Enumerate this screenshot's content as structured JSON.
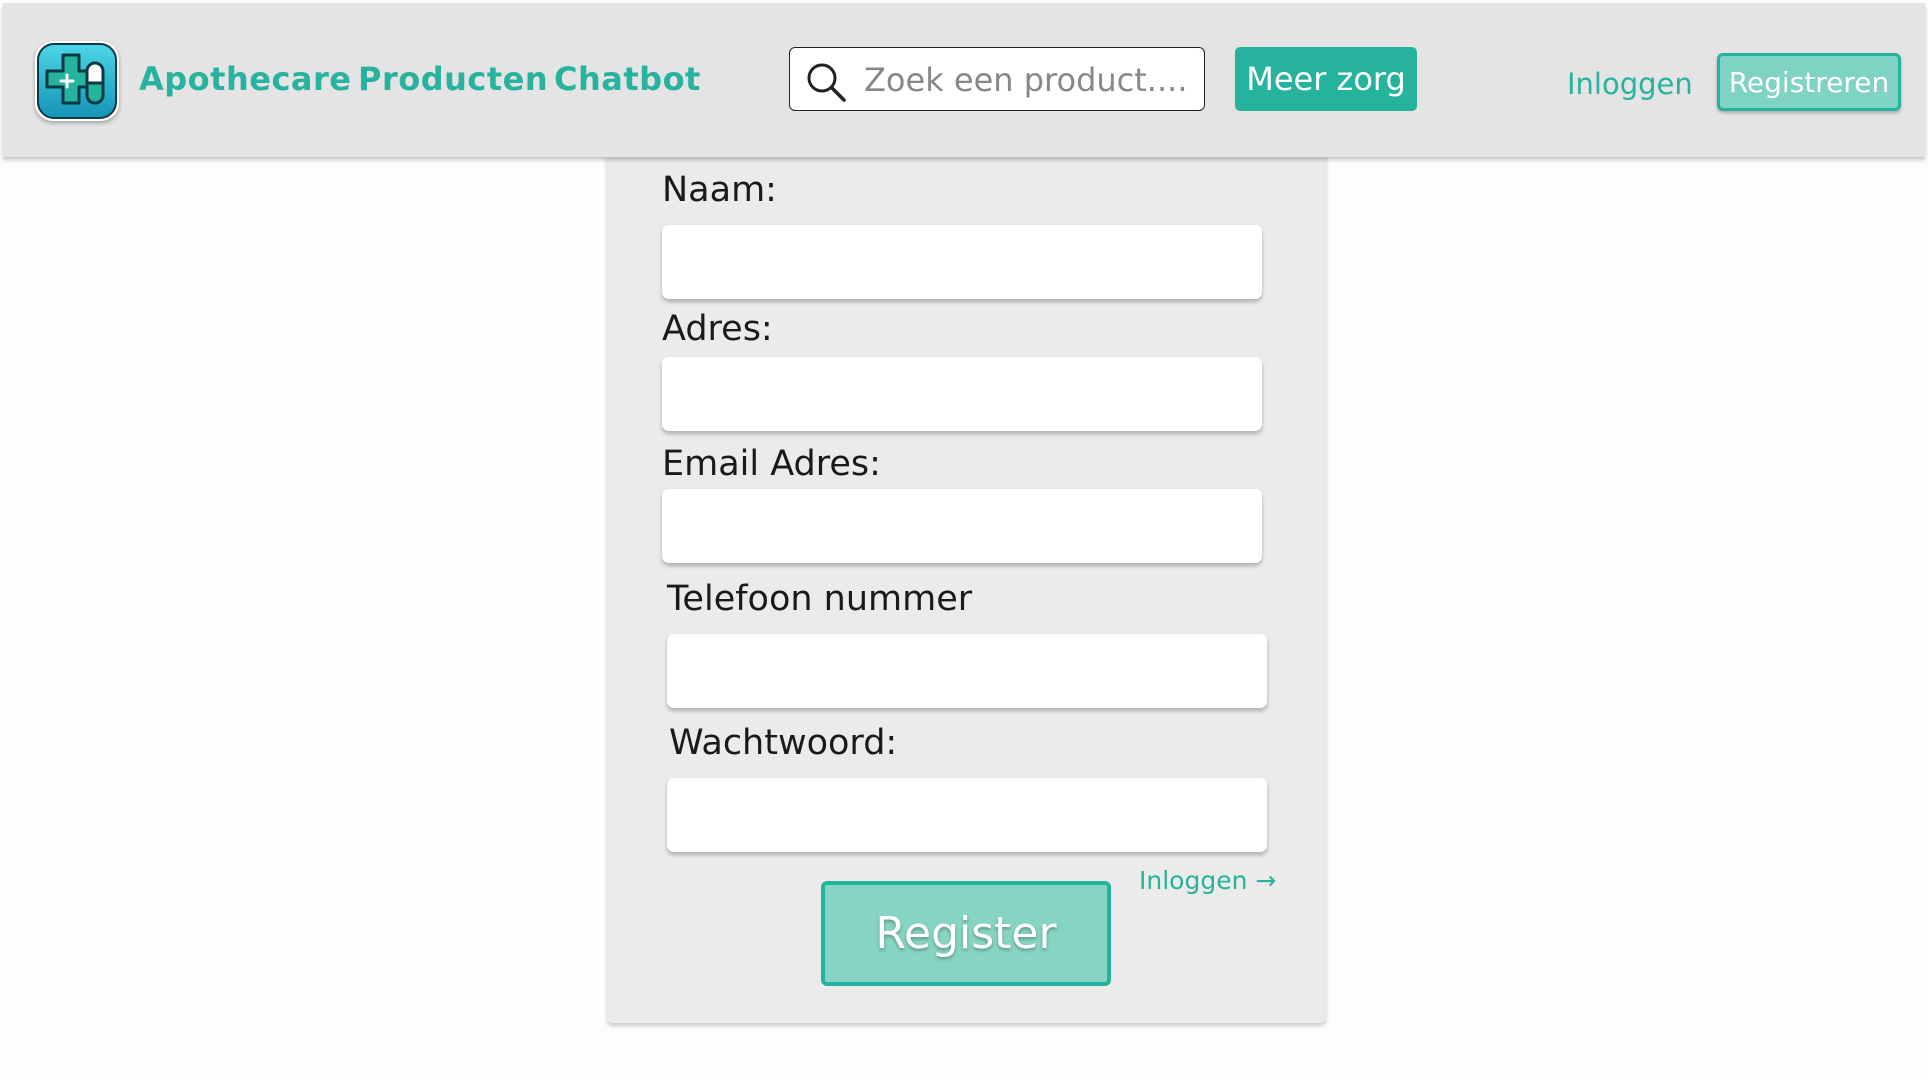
{
  "header": {
    "brand_label": "Apothecare",
    "nav": [
      {
        "label": "Producten"
      },
      {
        "label": "Chatbot"
      }
    ],
    "search": {
      "placeholder": "Zoek een product....",
      "value": ""
    },
    "meer_zorg_label": "Meer zorg",
    "login_label": "Inloggen",
    "register_label": "Registreren",
    "logo_icon": "medical-cross-pill-icon",
    "search_icon": "search-icon"
  },
  "form": {
    "fields": [
      {
        "label": "Naam:",
        "value": ""
      },
      {
        "label": "Adres:",
        "value": ""
      },
      {
        "label": "Email Adres:",
        "value": ""
      },
      {
        "label": "Telefoon nummer",
        "value": ""
      },
      {
        "label": "Wachtwoord:",
        "value": ""
      }
    ],
    "login_link": "Inloggen →",
    "submit_label": "Register"
  },
  "colors": {
    "accent": "#25b39e",
    "accent_light": "#86d4c3",
    "navbar_bg": "#e4e4e4",
    "card_bg": "#ebebeb"
  }
}
